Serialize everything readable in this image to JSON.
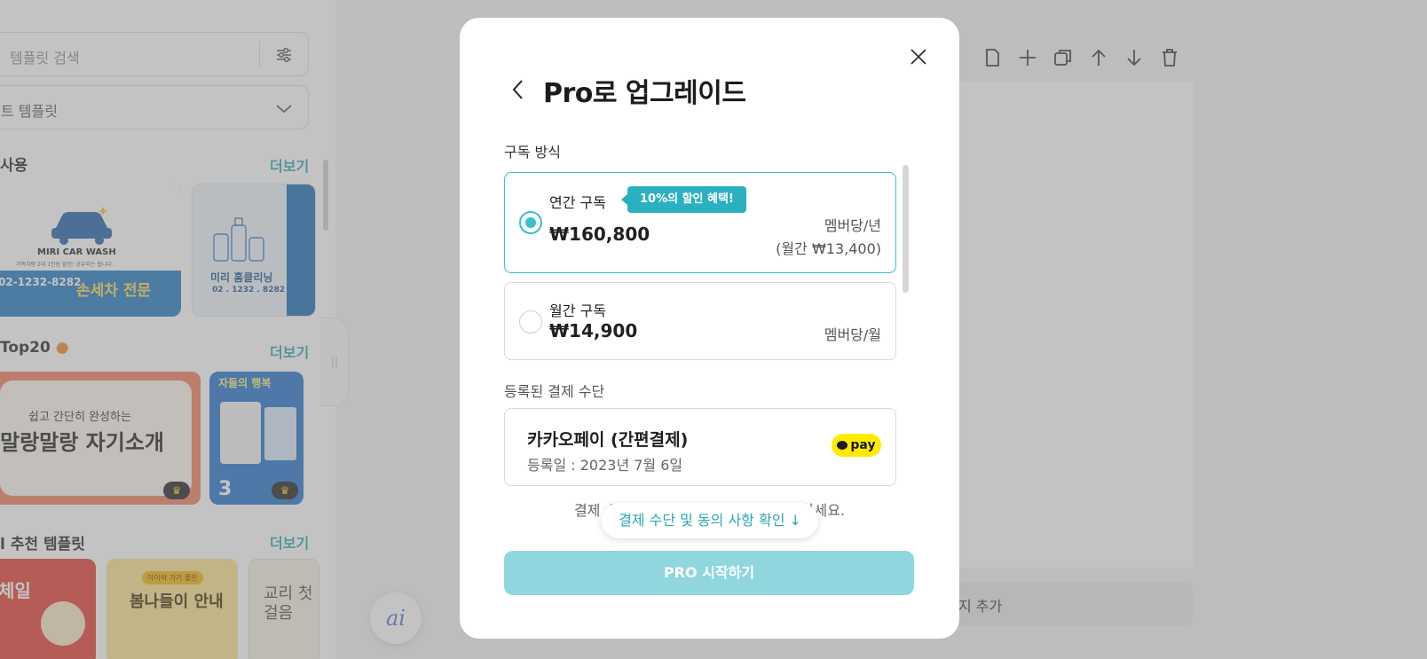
{
  "sidebar": {
    "search_placeholder": "템플릿 검색",
    "category_select": "트 템플릿",
    "sections": [
      {
        "title": "사용",
        "more": "더보기"
      },
      {
        "title": "Top20",
        "more": "더보기"
      },
      {
        "title": "l 추천 템플릿",
        "more": "더보기"
      }
    ],
    "cards": {
      "car_wash_brand": "MIRI CAR WASH",
      "car_wash_sub": "가족차량 2대 1만원 할인! 공유되는 됩니다.",
      "car_wash_phone": "02-1232-8282",
      "car_wash_tag": "손세차 전문",
      "cleaning_title": "미리 홈클리닝",
      "cleaning_phone": "02 . 1232 . 8282",
      "intro_sub": "쉽고 간단히 완성하는",
      "intro_title": "말랑말랑 자기소개",
      "election_top": "자들의 행복",
      "election_num": "3",
      "event_title": "체일",
      "spring_label": "아이와 가기 좋은",
      "spring_title": "봄나들이 안내",
      "misc_title": "교리 첫걸음"
    }
  },
  "editor": {
    "add_page_label": "지 추가"
  },
  "modal": {
    "title": "Pro로 업그레이드",
    "subscription_label": "구독 방식",
    "plans": [
      {
        "name": "연간 구독",
        "badge": "10%의 할인 혜택!",
        "price": "₩160,800",
        "unit": "멤버당/년",
        "monthly_equiv": "(월간 ₩13,400)",
        "selected": true
      },
      {
        "name": "월간 구독",
        "price": "₩14,900",
        "unit": "멤버당/월",
        "selected": false
      }
    ],
    "payment_label": "등록된 결제 수단",
    "payment_method": {
      "name": "카카오페이 (간편결제)",
      "registered": "등록일 : 2023년 7월 6일",
      "badge": "pay"
    },
    "consent_note": "결제 수단을 변경하시려면 아래를 클릭하세요.",
    "confirm_pill": "결제 수단 및 동의 사항 확인 ↓",
    "start_button": "PRO 시작하기"
  },
  "colors": {
    "accent": "#39bfcd",
    "accent_dark": "#2aa6b3",
    "start_button_bg": "#8fd6df",
    "kakao_yellow": "#ffeb00"
  }
}
